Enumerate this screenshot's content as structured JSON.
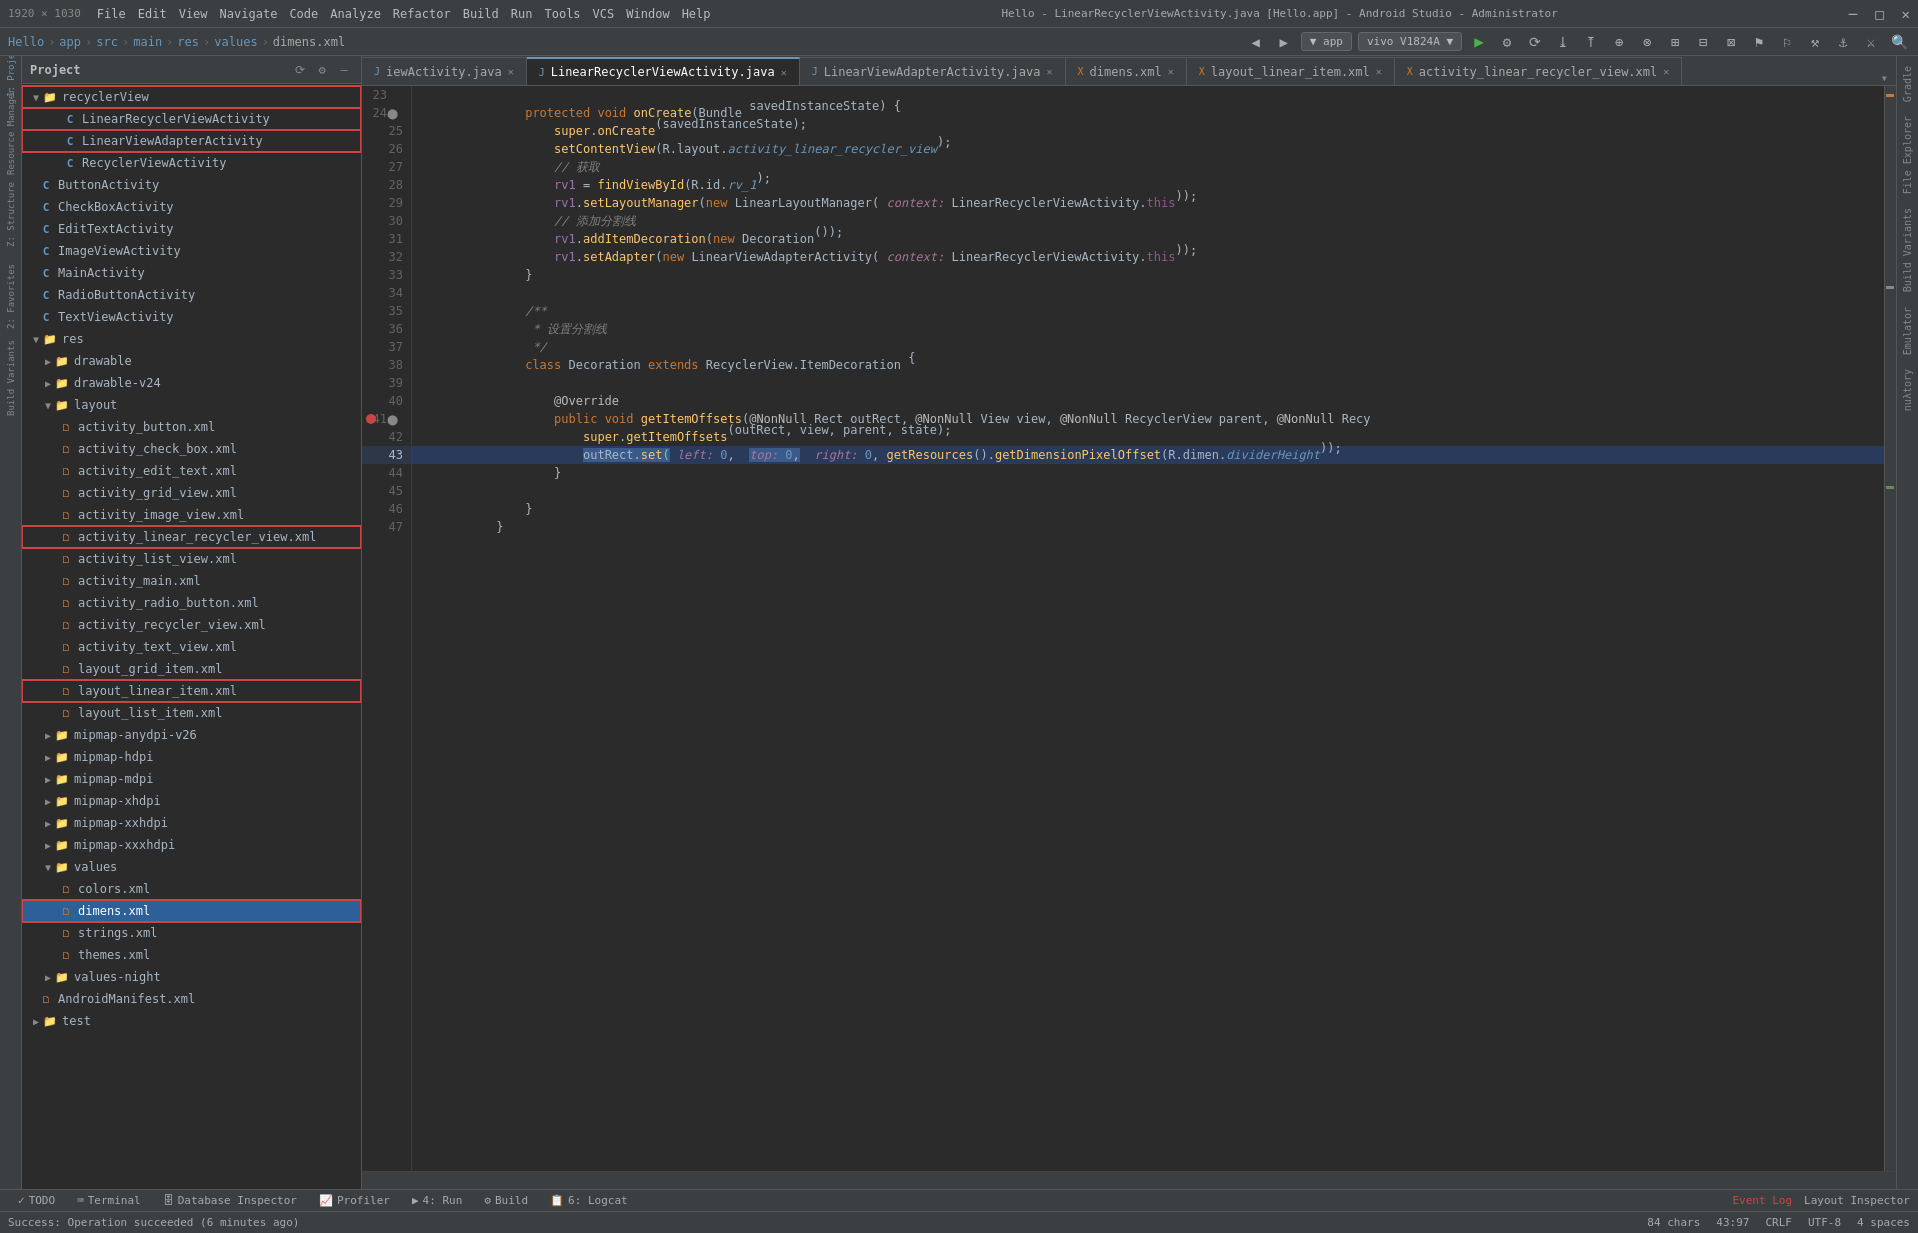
{
  "titleBar": {
    "resolution": "1920 × 1030",
    "menus": [
      "File",
      "Edit",
      "View",
      "Navigate",
      "Code",
      "Analyze",
      "Refactor",
      "Build",
      "Run",
      "Tools",
      "VCS",
      "Window",
      "Help"
    ],
    "title": "Hello - LinearRecyclerViewActivity.java [Hello.app] - Android Studio - Administrator",
    "minimizeLabel": "─",
    "maximizeLabel": "□",
    "closeLabel": "✕"
  },
  "navBar": {
    "breadcrumbs": [
      "Hello",
      "app",
      "src",
      "main",
      "res",
      "values",
      "dimens.xml"
    ]
  },
  "toolbar": {
    "appLabel": "▼ app",
    "deviceLabel": "vivo V1824A ▼",
    "runLabel": "▶",
    "searchLabel": "🔍"
  },
  "projectPanel": {
    "title": "Project",
    "items": [
      {
        "id": "recyclerView",
        "label": "recyclerView",
        "type": "folder",
        "indent": 8,
        "expanded": true
      },
      {
        "id": "LinearRecyclerViewActivity",
        "label": "LinearRecyclerViewActivity",
        "type": "java",
        "indent": 28,
        "highlighted": true
      },
      {
        "id": "LinearViewAdapterActivity",
        "label": "LinearViewAdapterActivity",
        "type": "java",
        "indent": 28,
        "highlighted": true
      },
      {
        "id": "RecyclerViewActivity",
        "label": "RecyclerViewActivity",
        "type": "java",
        "indent": 28
      },
      {
        "id": "ButtonActivity",
        "label": "ButtonActivity",
        "type": "java",
        "indent": 16
      },
      {
        "id": "CheckBoxActivity",
        "label": "CheckBoxActivity",
        "type": "java",
        "indent": 16
      },
      {
        "id": "EditTextActivity",
        "label": "EditTextActivity",
        "type": "java",
        "indent": 16
      },
      {
        "id": "ImageViewActivity",
        "label": "ImageViewActivity",
        "type": "java",
        "indent": 16
      },
      {
        "id": "MainActivity",
        "label": "MainActivity",
        "type": "java",
        "indent": 16
      },
      {
        "id": "RadioButtonActivity",
        "label": "RadioButtonActivity",
        "type": "java",
        "indent": 16
      },
      {
        "id": "TextViewActivity",
        "label": "TextViewActivity",
        "type": "java",
        "indent": 16
      },
      {
        "id": "res",
        "label": "res",
        "type": "folder",
        "indent": 8,
        "expanded": true
      },
      {
        "id": "drawable",
        "label": "drawable",
        "type": "folder",
        "indent": 20
      },
      {
        "id": "drawable-v24",
        "label": "drawable-v24",
        "type": "folder",
        "indent": 20
      },
      {
        "id": "layout",
        "label": "layout",
        "type": "folder",
        "indent": 20,
        "expanded": true
      },
      {
        "id": "activity_button.xml",
        "label": "activity_button.xml",
        "type": "xml",
        "indent": 36
      },
      {
        "id": "activity_check_box.xml",
        "label": "activity_check_box.xml",
        "type": "xml",
        "indent": 36
      },
      {
        "id": "activity_edit_text.xml",
        "label": "activity_edit_text.xml",
        "type": "xml",
        "indent": 36
      },
      {
        "id": "activity_grid_view.xml",
        "label": "activity_grid_view.xml",
        "type": "xml",
        "indent": 36
      },
      {
        "id": "activity_image_view.xml",
        "label": "activity_image_view.xml",
        "type": "xml",
        "indent": 36
      },
      {
        "id": "activity_linear_recycler_view.xml",
        "label": "activity_linear_recycler_view.xml",
        "type": "xml",
        "indent": 36,
        "highlighted": true
      },
      {
        "id": "activity_list_view.xml",
        "label": "activity_list_view.xml",
        "type": "xml",
        "indent": 36
      },
      {
        "id": "activity_main.xml",
        "label": "activity_main.xml",
        "type": "xml",
        "indent": 36
      },
      {
        "id": "activity_radio_button.xml",
        "label": "activity_radio_button.xml",
        "type": "xml",
        "indent": 36
      },
      {
        "id": "activity_recycler_view.xml",
        "label": "activity_recycler_view.xml",
        "type": "xml",
        "indent": 36
      },
      {
        "id": "activity_text_view.xml",
        "label": "activity_text_view.xml",
        "type": "xml",
        "indent": 36
      },
      {
        "id": "layout_grid_item.xml",
        "label": "layout_grid_item.xml",
        "type": "xml",
        "indent": 36
      },
      {
        "id": "layout_linear_item.xml",
        "label": "layout_linear_item.xml",
        "type": "xml",
        "indent": 36,
        "highlighted": true
      },
      {
        "id": "layout_list_item.xml",
        "label": "layout_list_item.xml",
        "type": "xml",
        "indent": 36
      },
      {
        "id": "mipmap-anydpi-v26",
        "label": "mipmap-anydpi-v26",
        "type": "folder",
        "indent": 20
      },
      {
        "id": "mipmap-hdpi",
        "label": "mipmap-hdpi",
        "type": "folder",
        "indent": 20
      },
      {
        "id": "mipmap-mdpi",
        "label": "mipmap-mdpi",
        "type": "folder",
        "indent": 20
      },
      {
        "id": "mipmap-xhdpi",
        "label": "mipmap-xhdpi",
        "type": "folder",
        "indent": 20
      },
      {
        "id": "mipmap-xxhdpi",
        "label": "mipmap-xxhdpi",
        "type": "folder",
        "indent": 20
      },
      {
        "id": "mipmap-xxxhdpi",
        "label": "mipmap-xxxhdpi",
        "type": "folder",
        "indent": 20
      },
      {
        "id": "values",
        "label": "values",
        "type": "folder",
        "indent": 20,
        "expanded": true
      },
      {
        "id": "colors.xml",
        "label": "colors.xml",
        "type": "xml",
        "indent": 36
      },
      {
        "id": "dimens.xml",
        "label": "dimens.xml",
        "type": "xml",
        "indent": 36,
        "selected": true,
        "highlighted": true
      },
      {
        "id": "strings.xml",
        "label": "strings.xml",
        "type": "xml",
        "indent": 36
      },
      {
        "id": "themes.xml",
        "label": "themes.xml",
        "type": "xml",
        "indent": 36
      },
      {
        "id": "values-night",
        "label": "values-night",
        "type": "folder",
        "indent": 20
      },
      {
        "id": "AndroidManifest.xml",
        "label": "AndroidManifest.xml",
        "type": "xml",
        "indent": 16
      },
      {
        "id": "test",
        "label": "test",
        "type": "folder",
        "indent": 8
      }
    ]
  },
  "editorTabs": [
    {
      "id": "tab1",
      "label": "iewActivity.java",
      "type": "java",
      "modified": false
    },
    {
      "id": "tab2",
      "label": "LinearRecyclerViewActivity.java",
      "type": "java",
      "modified": false,
      "active": true
    },
    {
      "id": "tab3",
      "label": "LinearViewAdapterActivity.java",
      "type": "java",
      "modified": false
    },
    {
      "id": "tab4",
      "label": "dimens.xml",
      "type": "xml",
      "modified": false
    },
    {
      "id": "tab5",
      "label": "layout_linear_item.xml",
      "type": "xml",
      "modified": false
    },
    {
      "id": "tab6",
      "label": "activity_linear_recycler_view.xml",
      "type": "xml",
      "modified": false
    }
  ],
  "codeLines": [
    {
      "num": 23,
      "content": "",
      "type": "blank"
    },
    {
      "num": 24,
      "content": "    protected void onCreate(Bundle savedInstanceState) {",
      "type": "code"
    },
    {
      "num": 25,
      "content": "        super.onCreate(savedInstanceState);",
      "type": "code"
    },
    {
      "num": 26,
      "content": "        setContentView(R.layout.activity_linear_recycler_view);",
      "type": "code"
    },
    {
      "num": 27,
      "content": "        // 获取",
      "type": "comment"
    },
    {
      "num": 28,
      "content": "        rv1 = findViewById(R.id.rv_1);",
      "type": "code"
    },
    {
      "num": 29,
      "content": "        rv1.setLayoutManager(new LinearLayoutManager( context: LinearRecyclerViewActivity.this));",
      "type": "code"
    },
    {
      "num": 30,
      "content": "        // 添加分割线",
      "type": "comment"
    },
    {
      "num": 31,
      "content": "        rv1.addItemDecoration(new Decoration());",
      "type": "code"
    },
    {
      "num": 32,
      "content": "        rv1.setAdapter(new LinearViewAdapterActivity( context: LinearRecyclerViewActivity.this));",
      "type": "code"
    },
    {
      "num": 33,
      "content": "    }",
      "type": "code"
    },
    {
      "num": 34,
      "content": "",
      "type": "blank"
    },
    {
      "num": 35,
      "content": "    /**",
      "type": "comment"
    },
    {
      "num": 36,
      "content": "     * 设置分割线",
      "type": "comment"
    },
    {
      "num": 37,
      "content": "     */",
      "type": "comment"
    },
    {
      "num": 38,
      "content": "    class Decoration extends RecyclerView.ItemDecoration {",
      "type": "code"
    },
    {
      "num": 39,
      "content": "",
      "type": "blank"
    },
    {
      "num": 40,
      "content": "        @Override",
      "type": "annotation"
    },
    {
      "num": 41,
      "content": "        public void getItemOffsets(@NonNull Rect outRect, @NonNull View view, @NonNull RecyclerView parent, @NonNull Recy",
      "type": "code",
      "hasBreakpoint": true
    },
    {
      "num": 42,
      "content": "            super.getItemOffsets(outRect, view, parent, state);",
      "type": "code"
    },
    {
      "num": 43,
      "content": "            outRect.set( left: 0,  top: 0,  right: 0, getResources().getDimensionPixelOffset(R.dimen.dividerHeight));",
      "type": "code",
      "highlighted": true
    },
    {
      "num": 44,
      "content": "        }",
      "type": "code"
    },
    {
      "num": 45,
      "content": "",
      "type": "blank"
    },
    {
      "num": 46,
      "content": "    }",
      "type": "code"
    },
    {
      "num": 47,
      "content": "}",
      "type": "code"
    }
  ],
  "bottomTabs": [
    {
      "id": "todo",
      "label": "TODO"
    },
    {
      "id": "terminal",
      "label": "Terminal"
    },
    {
      "id": "db",
      "label": "Database Inspector"
    },
    {
      "id": "profiler",
      "label": "Profiler"
    },
    {
      "id": "run",
      "label": "4: Run"
    },
    {
      "id": "build",
      "label": "Build"
    },
    {
      "id": "logcat",
      "label": "6: Logcat"
    }
  ],
  "statusBar": {
    "message": "Success: Operation succeeded (6 minutes ago)",
    "errorLog": "Event Log",
    "layoutInspector": "Layout Inspector",
    "position": "43:97",
    "lineInfo": "84 chars",
    "encoding": "CRLF",
    "fileType": "UTF-8",
    "spaces": "4 spaces"
  },
  "rightSidebarItems": [
    "Gradle",
    "File Explorer",
    "Build Variants",
    "Emulator",
    "nuλtory"
  ]
}
